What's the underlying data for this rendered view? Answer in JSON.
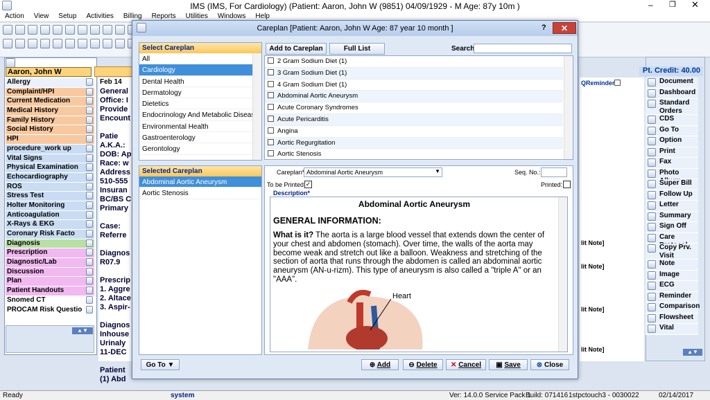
{
  "app": {
    "title": "IMS (IMS, For Cardiology)    (Patient: Aaron, John W (9851) 04/09/1929 - M Age: 87y 10m )"
  },
  "menu": [
    "Action",
    "View",
    "Setup",
    "Activities",
    "Billing",
    "Reports",
    "Utilities",
    "Windows",
    "Help"
  ],
  "patient": {
    "name": "Aaron, John W",
    "credit": "Pt. Credit: 40.00",
    "feb": "Feb 14"
  },
  "left_nav": [
    {
      "label": "Allergy",
      "c": "c-w"
    },
    {
      "label": "Complaint/HPI",
      "c": "c-o"
    },
    {
      "label": "Current Medication",
      "c": "c-o"
    },
    {
      "label": "Medical History",
      "c": "c-o"
    },
    {
      "label": "Family History",
      "c": "c-o"
    },
    {
      "label": "Social History",
      "c": "c-o"
    },
    {
      "label": "HPI",
      "c": "c-o"
    },
    {
      "label": "procedure_work up",
      "c": "c-b"
    },
    {
      "label": "Vital Signs",
      "c": "c-b"
    },
    {
      "label": "Physical Examination",
      "c": "c-b"
    },
    {
      "label": "Echocardiography",
      "c": "c-b"
    },
    {
      "label": "ROS",
      "c": "c-b"
    },
    {
      "label": "Stress Test",
      "c": "c-b"
    },
    {
      "label": "Holter Monitoring",
      "c": "c-b"
    },
    {
      "label": "Anticoagulation",
      "c": "c-b"
    },
    {
      "label": "X-Rays & EKG",
      "c": "c-b"
    },
    {
      "label": "Coronary Risk Facto",
      "c": "c-b"
    },
    {
      "label": "Diagnosis",
      "c": "c-g"
    },
    {
      "label": "Prescription",
      "c": "c-p"
    },
    {
      "label": "Diagnostic/Lab",
      "c": "c-p"
    },
    {
      "label": "Discussion",
      "c": "c-p"
    },
    {
      "label": "Plan",
      "c": "c-p"
    },
    {
      "label": "Patient Handouts",
      "c": "c-p"
    },
    {
      "label": "Snomed CT",
      "c": "c-x"
    },
    {
      "label": "PROCAM Risk Questio",
      "c": "c-x"
    }
  ],
  "mid_lines": [
    "General",
    "Office: I",
    "Provide",
    "Encount",
    "",
    "Patie",
    "A.K.A.:",
    "DOB: Ap",
    "Race: w",
    "Address",
    "510-555",
    "Insuran",
    "BC/BS C",
    "Primary",
    "",
    "Case:",
    "Referre",
    "",
    "Diagnos",
    "R07.9",
    "",
    "Prescrip",
    "1. Aggre",
    "2. Altace",
    "3. Aspir-",
    "",
    "Diagnos",
    "Inhouse",
    "  Urinaly",
    "  11-DEC",
    "",
    "Patient",
    "(1) Abd"
  ],
  "right_nav": [
    "Document",
    "Dashboard",
    "Standard Orders",
    "CDS",
    "Go To",
    "Option",
    "Print",
    "Fax",
    "Photo Album",
    "Super Bill",
    "Follow Up",
    "Letter",
    "Summary",
    "Sign Off",
    "Care Protocol",
    "Copy Prv. Visit",
    "Note",
    "Image",
    "ECG",
    "Reminder",
    "Comparison",
    "Flowsheet",
    "Vital"
  ],
  "strip": {
    "reminder": "QReminder",
    "notes": [
      "lit Note]",
      "lit Note]",
      "lit Note]",
      "lit Note]"
    ]
  },
  "dialog": {
    "title": "Careplan  [Patient: Aaron, John W  Age: 87 year 10 month ]",
    "help": "?",
    "close": "✕",
    "select_header": "Select Careplan",
    "categories": [
      "All",
      "Cardiology",
      "Dental Health",
      "Dermatology",
      "Dietetics",
      "Endocrinology And Metabolic Disease",
      "Environmental Health",
      "Gastroenterology",
      "Gerontology"
    ],
    "selected_category": 1,
    "add_btn": "Add to Careplan",
    "full_list": "Full List",
    "search_label": "Search:",
    "search_value": "",
    "careplans": [
      "2 Gram Sodium Diet (1)",
      "3 Gram Sodium Diet (1)",
      "4 Gram Sodium Diet (1)",
      "Abdominal Aortic Aneurysm",
      "Acute Coronary Syndromes",
      "Acute Pericarditis",
      "Angina",
      "Aortic Regurgitation",
      "Aortic Stenosis"
    ],
    "selected_header": "Selected Careplan",
    "selected_list": [
      "Abdominal Aortic Aneurysm",
      "Aortic Stenosis"
    ],
    "careplan_label": "Careplan*",
    "careplan_value": "Abdominal Aortic Aneurysm",
    "seq_label": "Seq. No.:",
    "printed_label": "Printed:",
    "to_print_label": "To be Printed:",
    "desc_label": "Description*",
    "doc_title": "Abdominal Aortic Aneurysm",
    "doc_h2": "GENERAL INFORMATION:",
    "doc_q": "What is it?",
    "doc_text": "The aorta is a large blood vessel that extends down the center of your chest and abdomen (stomach). Over time, the walls of the aorta may become weak and stretch out like a balloon. Weakness and stretching of the section of aorta that runs through the abdomen is called an abdominal aortic aneurysm (AN-u-rizm). This type of aneurysm is also called a \"triple A\" or an \"AAA\".",
    "heart_label": "Heart",
    "goto": "Go To",
    "buttons": {
      "add": "Add",
      "delete": "Delete",
      "cancel": "Cancel",
      "save": "Save",
      "close": "Close"
    }
  },
  "status": {
    "ready": "Ready",
    "user": "system",
    "ver": "Ver: 14.0.0 Service Pack 1",
    "build": "Build: 071416",
    "host": "1stpctouch3 - 0030022",
    "date": "02/14/2017"
  }
}
